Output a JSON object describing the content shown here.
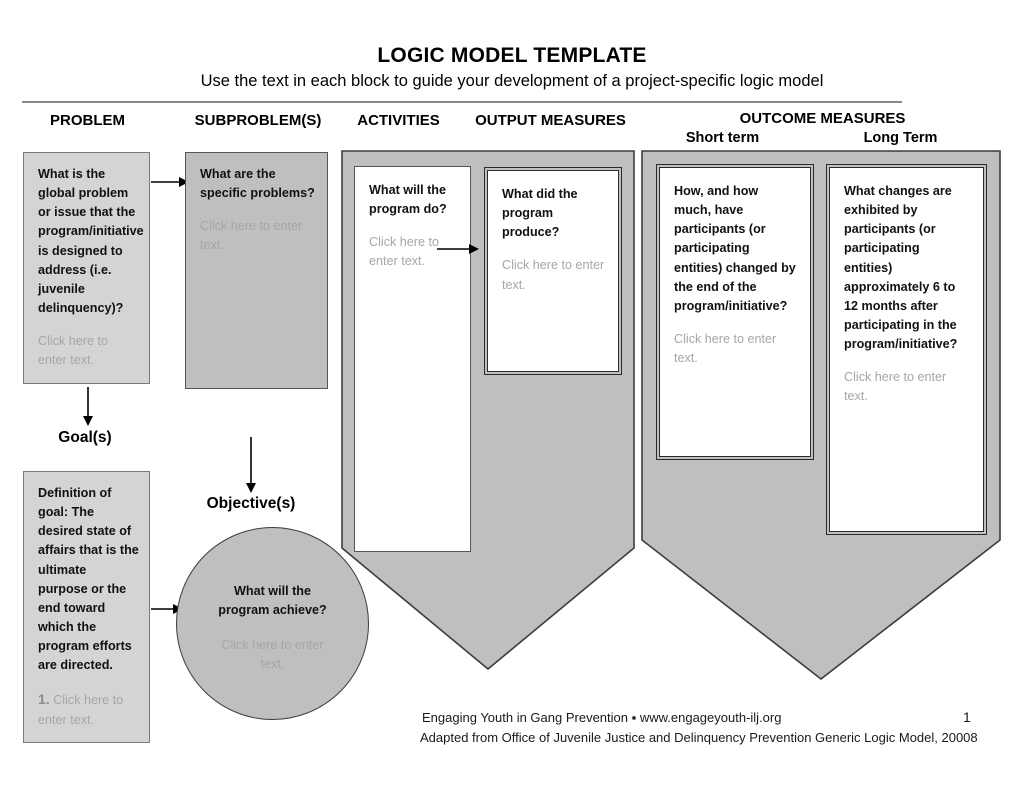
{
  "document": {
    "title": "LOGIC MODEL TEMPLATE",
    "subtitle": "Use the text in each block to guide your development of a project-specific logic model"
  },
  "columns": {
    "problem": "PROBLEM",
    "subproblems": "SUBPROBLEM(S)",
    "activities": "ACTIVITIES",
    "output_measures": "OUTPUT MEASURES",
    "outcome_measures": "OUTCOME MEASURES",
    "short_term": "Short term",
    "long_term": "Long Term"
  },
  "blocks": {
    "problem": {
      "prompt": "What is the global problem or issue that the program/initiative is designed to address (i.e. juvenile delinquency)?",
      "placeholder": "Click here to enter text."
    },
    "subproblem": {
      "prompt": "What are the specific problems?",
      "placeholder": "Click here to enter text."
    },
    "activities": {
      "prompt": "What will the program do?",
      "placeholder": "Click here to enter text."
    },
    "output": {
      "prompt": "What did the program produce?",
      "placeholder": "Click here to enter text."
    },
    "short_term": {
      "prompt": "How, and how much, have participants (or participating entities) changed by the end of the program/initiative?",
      "placeholder": "Click here to enter text."
    },
    "long_term": {
      "prompt": "What changes are exhibited by participants (or participating entities) approximately 6 to 12 months after participating in the program/initiative?",
      "placeholder": "Click here to enter text."
    },
    "goal": {
      "label": "Goal(s)",
      "prompt": "Definition of goal: The desired state of affairs that is the ultimate purpose or the end toward which the program efforts are directed.",
      "number": "1.",
      "placeholder": "Click here to enter text."
    },
    "objective": {
      "label": "Objective(s)",
      "prompt": "What will the program achieve?",
      "placeholder": "Click here to enter text."
    }
  },
  "footer": {
    "line1": "Engaging Youth in Gang Prevention ▪ www.engageyouth-ilj.org",
    "line2": "Adapted from Office of Juvenile Justice and Delinquency Prevention Generic Logic Model, 20008",
    "page_number": "1"
  },
  "colors": {
    "shape_fill": "#bfbfbf",
    "box_fill": "#d4d4d4",
    "white_fill": "#ffffff",
    "outline": "#3d3d3d",
    "placeholder_text": "#a6a6a6",
    "rule": "#888888"
  }
}
